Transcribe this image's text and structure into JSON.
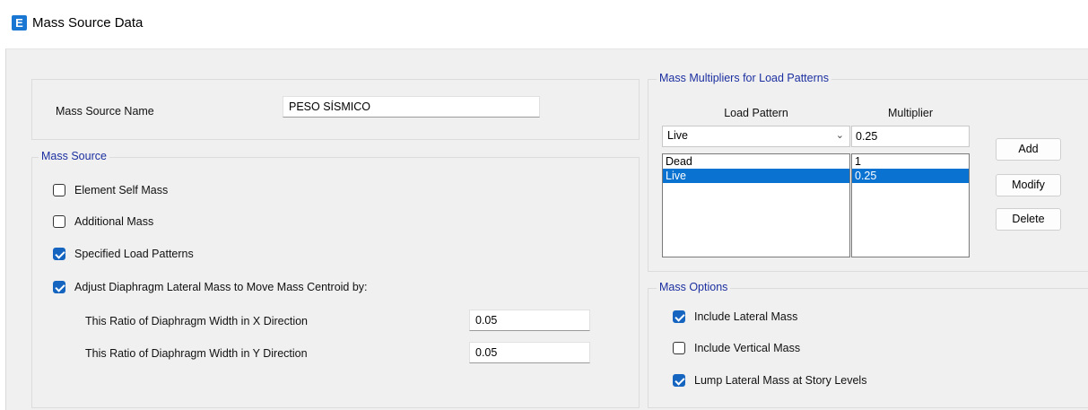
{
  "window": {
    "icon_letter": "E",
    "title": "Mass Source Data"
  },
  "name_panel": {
    "label": "Mass Source Name",
    "value": "PESO SÍSMICO"
  },
  "mass_source": {
    "title": "Mass Source",
    "checkboxes": [
      {
        "label": "Element Self Mass",
        "checked": false
      },
      {
        "label": "Additional Mass",
        "checked": false
      },
      {
        "label": "Specified Load Patterns",
        "checked": true
      },
      {
        "label": "Adjust Diaphragm Lateral Mass to Move Mass Centroid by:",
        "checked": true
      }
    ],
    "ratio_x_label": "This Ratio of Diaphragm Width in X Direction",
    "ratio_x_value": "0.05",
    "ratio_y_label": "This Ratio of Diaphragm Width in Y Direction",
    "ratio_y_value": "0.05"
  },
  "multipliers": {
    "title": "Mass Multipliers for Load Patterns",
    "col_load_pattern": "Load Pattern",
    "col_multiplier": "Multiplier",
    "selected_pattern": "Live",
    "multiplier_value": "0.25",
    "rows": [
      {
        "pattern": "Dead",
        "multiplier": "1",
        "selected": false
      },
      {
        "pattern": "Live",
        "multiplier": "0.25",
        "selected": true
      }
    ],
    "buttons": {
      "add": "Add",
      "modify": "Modify",
      "delete": "Delete"
    }
  },
  "mass_options": {
    "title": "Mass Options",
    "checkboxes": [
      {
        "label": "Include Lateral Mass",
        "checked": true
      },
      {
        "label": "Include Vertical Mass",
        "checked": false
      },
      {
        "label": "Lump Lateral Mass at Story Levels",
        "checked": true
      }
    ]
  },
  "icons": {
    "app": "etabs-app-icon",
    "dropdown": "chevron-down-icon",
    "check": "checkmark-icon"
  },
  "colors": {
    "accent": "#1565c0",
    "selection": "#0a72d1",
    "group_title": "#1c2fa0"
  }
}
